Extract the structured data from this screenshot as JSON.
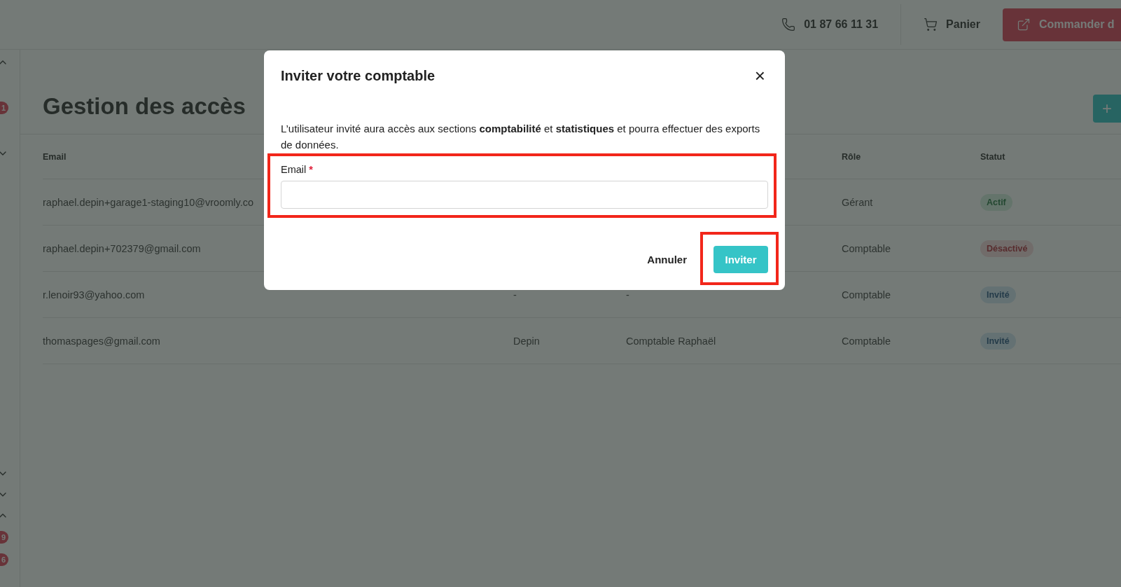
{
  "header": {
    "phone": "01 87 66 11 31",
    "cart": "Panier",
    "order_button": "Commander d"
  },
  "sidebar": {
    "top": [
      {
        "kind": "chevron",
        "expanded": true
      },
      {
        "kind": "badge",
        "count": "1"
      },
      {
        "kind": "chevron",
        "expanded": false
      }
    ],
    "bottom": [
      {
        "kind": "chevron",
        "expanded": false
      },
      {
        "kind": "chevron",
        "expanded": false
      },
      {
        "kind": "chevron",
        "expanded": true
      },
      {
        "kind": "badge",
        "count": "9"
      },
      {
        "kind": "badge",
        "count": "6"
      }
    ]
  },
  "page": {
    "title": "Gestion des accès",
    "add_button": "+"
  },
  "table": {
    "columns": [
      "Email",
      "",
      "",
      "Rôle",
      "Statut"
    ],
    "rows": [
      {
        "email": "raphael.depin+garage1-staging10@vroomly.co",
        "role": "Gérant",
        "status": {
          "label": "Actif",
          "kind": "active"
        }
      },
      {
        "email": "raphael.depin+702379@gmail.com",
        "role": "Comptable",
        "status": {
          "label": "Désactivé",
          "kind": "disabled"
        }
      },
      {
        "email": "r.lenoir93@yahoo.com",
        "column_2": "-",
        "column_3": "-",
        "role": "Comptable",
        "status": {
          "label": "Invité",
          "kind": "invited"
        }
      },
      {
        "email": "thomaspages@gmail.com",
        "column_2": "Depin",
        "column_3": "Comptable Raphaël",
        "role": "Comptable",
        "status": {
          "label": "Invité",
          "kind": "invited"
        }
      }
    ]
  },
  "modal": {
    "title": "Inviter votre comptable",
    "close": "×",
    "description": "L’utilisateur invité aura accès aux sections **comptabilité** et **statistiques** et pourra effectuer des exports de données.",
    "email_label": "Email",
    "required_mark": "*",
    "cancel": "Annuler",
    "submit": "Inviter"
  }
}
